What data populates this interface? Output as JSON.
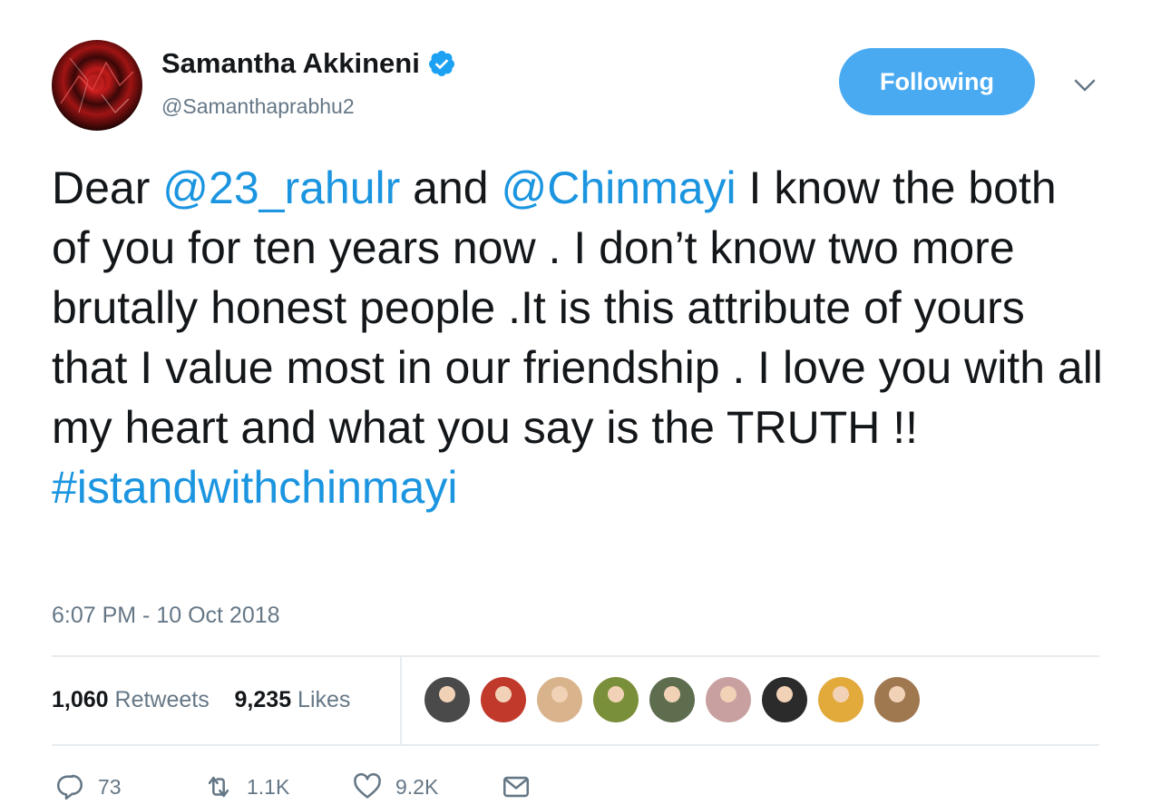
{
  "author": {
    "name": "Samantha Akkineni",
    "handle": "@Samanthaprabhu2",
    "verified_icon": "verified-badge-icon"
  },
  "follow_button": {
    "label": "Following"
  },
  "tweet": {
    "segments": [
      {
        "text": "Dear ",
        "type": "text"
      },
      {
        "text": "@23_rahulr",
        "type": "mention"
      },
      {
        "text": " and ",
        "type": "text"
      },
      {
        "text": "@Chinmayi",
        "type": "mention"
      },
      {
        "text": " I know the both of you for ten years now . I don’t know two more brutally honest people .It is this attribute of yours that I value most in our friendship . I love you with all my heart and what you say is the TRUTH !! ",
        "type": "text"
      },
      {
        "text": "#istandwithchinmayi",
        "type": "hashtag"
      }
    ]
  },
  "timestamp": "6:07 PM - 10 Oct 2018",
  "stats": {
    "retweets_count": "1,060",
    "retweets_label": "Retweets",
    "likes_count": "9,235",
    "likes_label": "Likes"
  },
  "likers": [
    {
      "color": "#4a4a4a"
    },
    {
      "color": "#c0392b"
    },
    {
      "color": "#d9b38c"
    },
    {
      "color": "#7a8f3a"
    },
    {
      "color": "#5d6d4e"
    },
    {
      "color": "#c8a0a0"
    },
    {
      "color": "#2b2b2b"
    },
    {
      "color": "#e2a93b"
    },
    {
      "color": "#a07850"
    }
  ],
  "actions": {
    "replies": "73",
    "retweets": "1.1K",
    "likes": "9.2K"
  },
  "colors": {
    "accent": "#1b95e0",
    "button": "#4aaaf1",
    "muted": "#657786"
  }
}
